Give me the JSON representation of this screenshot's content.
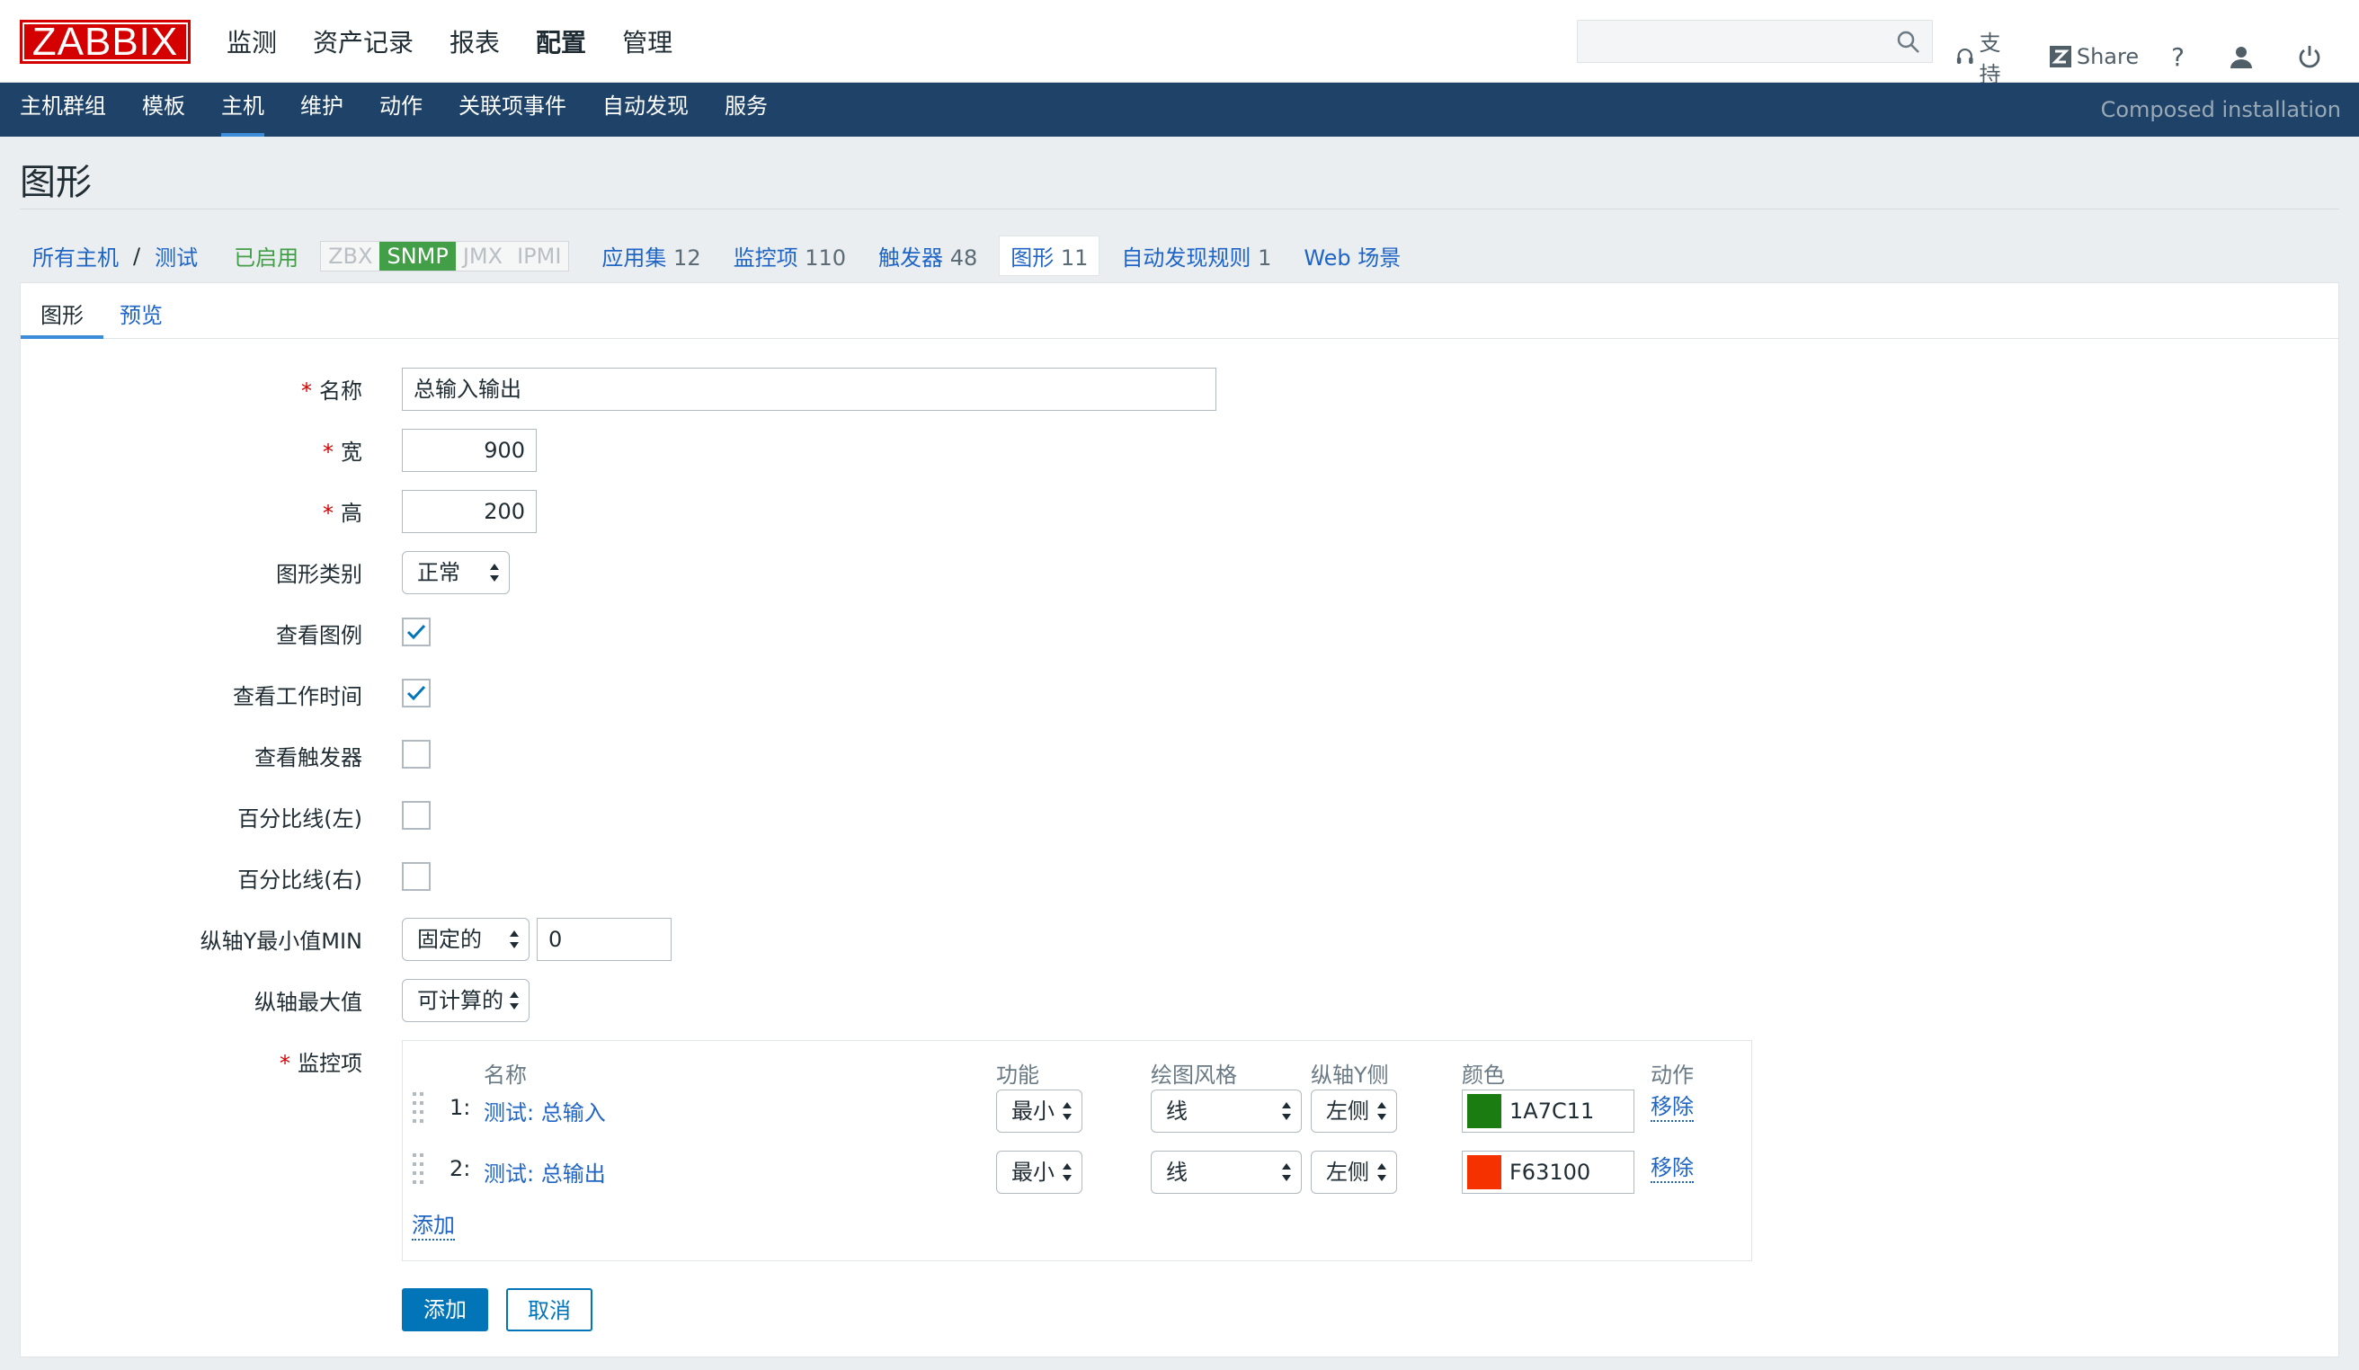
{
  "logo": "ZABBIX",
  "main_nav": [
    "监测",
    "资产记录",
    "报表",
    "配置",
    "管理"
  ],
  "main_nav_active": "配置",
  "search": {
    "placeholder": ""
  },
  "top_links": {
    "support": "支持",
    "share": "Share",
    "help": "?"
  },
  "sub_nav": [
    "主机群组",
    "模板",
    "主机",
    "维护",
    "动作",
    "关联项事件",
    "自动发现",
    "服务"
  ],
  "sub_nav_active": "主机",
  "sub_nav_right": "Composed installation",
  "page_title": "图形",
  "breadcrumb": {
    "all_hosts": "所有主机",
    "separator": "/",
    "host": "测试",
    "status": "已启用",
    "tags": [
      "ZBX",
      "SNMP",
      "JMX",
      "IPMI"
    ],
    "active_tag": "SNMP",
    "counts": [
      {
        "label": "应用集",
        "n": "12"
      },
      {
        "label": "监控项",
        "n": "110"
      },
      {
        "label": "触发器",
        "n": "48"
      },
      {
        "label": "图形",
        "n": "11"
      },
      {
        "label": "自动发现规则",
        "n": "1"
      },
      {
        "label": "Web 场景",
        "n": ""
      }
    ]
  },
  "tabs": [
    "图形",
    "预览"
  ],
  "form": {
    "name_label": "名称",
    "name_value": "总输入输出",
    "width_label": "宽",
    "width_value": "900",
    "height_label": "高",
    "height_value": "200",
    "graph_type_label": "图形类别",
    "graph_type_value": "正常",
    "show_legend_label": "查看图例",
    "show_legend": true,
    "show_worktime_label": "查看工作时间",
    "show_worktime": true,
    "show_triggers_label": "查看触发器",
    "show_triggers": false,
    "percentile_left_label": "百分比线(左)",
    "percentile_left": false,
    "percentile_right_label": "百分比线(右)",
    "percentile_right": false,
    "ymin_label": "纵轴Y最小值MIN",
    "ymin_type": "固定的",
    "ymin_value": "0",
    "ymax_label": "纵轴最大值",
    "ymax_type": "可计算的",
    "items_label": "监控项"
  },
  "items_table": {
    "headers": [
      "名称",
      "功能",
      "绘图风格",
      "纵轴Y侧",
      "颜色",
      "动作"
    ],
    "rows": [
      {
        "num": "1:",
        "name": "测试: 总输入",
        "func": "最小",
        "style": "线",
        "axis": "左侧",
        "color": "1A7C11",
        "color_hex": "#1A7C11",
        "action": "移除"
      },
      {
        "num": "2:",
        "name": "测试: 总输出",
        "func": "最小",
        "style": "线",
        "axis": "左侧",
        "color": "F63100",
        "color_hex": "#F63100",
        "action": "移除"
      }
    ],
    "add_link": "添加"
  },
  "buttons": {
    "add": "添加",
    "cancel": "取消"
  }
}
